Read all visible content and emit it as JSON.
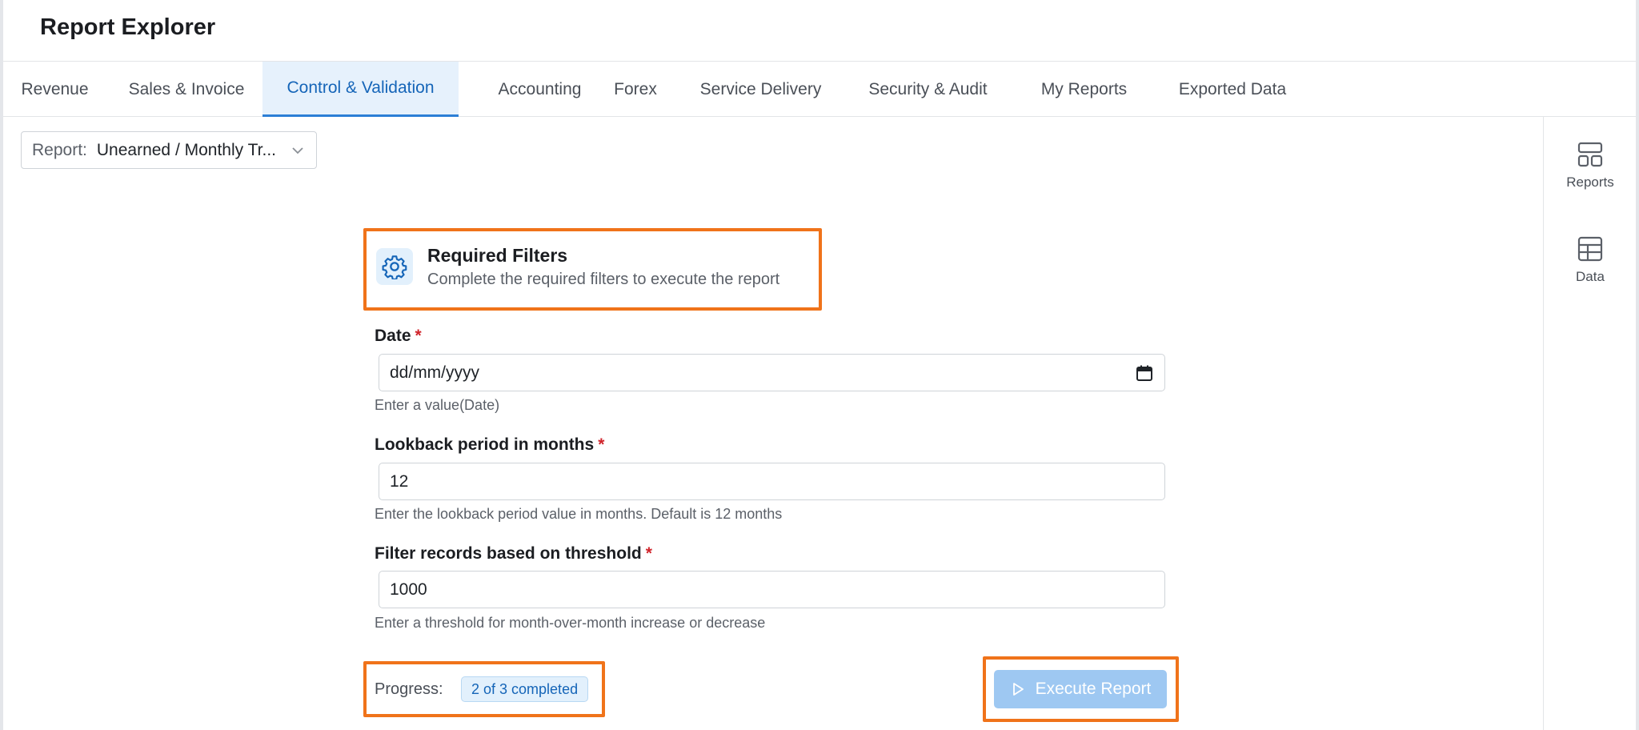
{
  "app": {
    "title": "Report Explorer"
  },
  "tabs": [
    {
      "label": "Revenue",
      "active": false
    },
    {
      "label": "Sales & Invoice",
      "active": false
    },
    {
      "label": "Control & Validation",
      "active": true
    },
    {
      "label": "Accounting",
      "active": false
    },
    {
      "label": "Forex",
      "active": false
    },
    {
      "label": "Service Delivery",
      "active": false
    },
    {
      "label": "Security & Audit",
      "active": false
    },
    {
      "label": "My Reports",
      "active": false
    },
    {
      "label": "Exported Data",
      "active": false
    }
  ],
  "report_select": {
    "label": "Report:",
    "value": "Unearned / Monthly Tr..."
  },
  "right_rail": {
    "reports_label": "Reports",
    "data_label": "Data"
  },
  "filters": {
    "title": "Required Filters",
    "subtitle": "Complete the required filters to execute the report",
    "required_marker": "*",
    "date": {
      "label": "Date",
      "placeholder": "dd/mm/yyyy",
      "help": "Enter a value(Date)"
    },
    "lookback": {
      "label": "Lookback period in months",
      "value": "12",
      "help": "Enter the lookback period value in months. Default is 12 months"
    },
    "threshold": {
      "label": "Filter records based on threshold",
      "value": "1000",
      "help": "Enter a threshold for month-over-month increase or decrease"
    }
  },
  "progress": {
    "label": "Progress:",
    "badge": "2 of 3 completed"
  },
  "execute": {
    "label": "Execute Report"
  },
  "colors": {
    "accent": "#2c7fd6",
    "highlight": "#f0731a",
    "required": "#d0242b",
    "button_disabled": "#9ec8f2"
  }
}
